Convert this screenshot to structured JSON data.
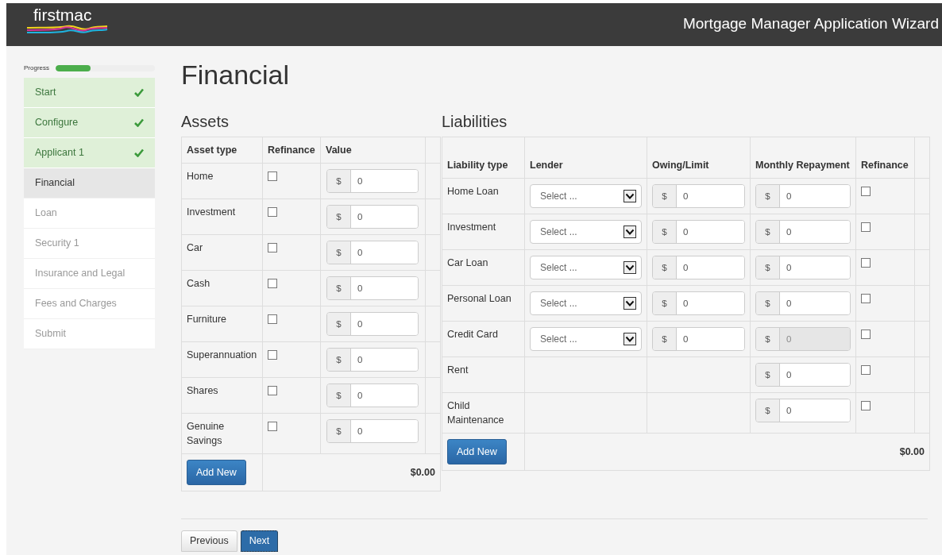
{
  "header": {
    "logo": "firstmac",
    "title": "Mortgage Manager Application Wizard"
  },
  "sidebar": {
    "progress_label": "Progress",
    "progress": {
      "level": 0.35
    },
    "steps": [
      {
        "label": "Start",
        "completed": true,
        "selected": false
      },
      {
        "label": "Configure",
        "completed": true,
        "selected": false
      },
      {
        "label": "Applicant 1",
        "completed": true,
        "selected": false
      },
      {
        "label": "Financial",
        "completed": false,
        "selected": true
      },
      {
        "label": "Loan",
        "completed": false,
        "selected": false
      },
      {
        "label": "Security 1",
        "completed": false,
        "selected": false
      },
      {
        "label": "Insurance and Legal",
        "completed": false,
        "selected": false
      },
      {
        "label": "Fees and Charges",
        "completed": false,
        "selected": false
      },
      {
        "label": "Submit",
        "completed": false,
        "selected": false
      }
    ]
  },
  "page_title": "Financial",
  "assets": {
    "heading": "Assets",
    "columns": [
      "Asset type",
      "Refinance",
      "Value"
    ],
    "rows": [
      {
        "type": "Home",
        "refinance": false,
        "currency": "$",
        "value": "0"
      },
      {
        "type": "Investment",
        "refinance": false,
        "currency": "$",
        "value": "0"
      },
      {
        "type": "Car",
        "refinance": false,
        "currency": "$",
        "value": "0"
      },
      {
        "type": "Cash",
        "refinance": false,
        "currency": "$",
        "value": "0"
      },
      {
        "type": "Furniture",
        "refinance": false,
        "currency": "$",
        "value": "0"
      },
      {
        "type": "Superannuation",
        "refinance": false,
        "currency": "$",
        "value": "0"
      },
      {
        "type": "Shares",
        "refinance": false,
        "currency": "$",
        "value": "0"
      },
      {
        "type": "Genuine Savings",
        "refinance": false,
        "currency": "$",
        "value": "0"
      }
    ],
    "add_button": "Add New",
    "total": "$0.00"
  },
  "liabilities": {
    "heading": "Liabilities",
    "columns": [
      "Liability type",
      "Lender",
      "Owing/Limit",
      "Monthly Repayment",
      "Refinance"
    ],
    "rows": [
      {
        "kind": "loan",
        "type": "Home Loan",
        "lender": "Select ...",
        "owing_currency": "$",
        "owing": "0",
        "repayment_currency": "$",
        "repayment": "0",
        "repayment_disabled": false,
        "refinance": false
      },
      {
        "kind": "loan",
        "type": "Investment",
        "lender": "Select ...",
        "owing_currency": "$",
        "owing": "0",
        "repayment_currency": "$",
        "repayment": "0",
        "repayment_disabled": false,
        "refinance": false
      },
      {
        "kind": "loan",
        "type": "Car Loan",
        "lender": "Select ...",
        "owing_currency": "$",
        "owing": "0",
        "repayment_currency": "$",
        "repayment": "0",
        "repayment_disabled": false,
        "refinance": false
      },
      {
        "kind": "loan",
        "type": "Personal Loan",
        "lender": "Select ...",
        "owing_currency": "$",
        "owing": "0",
        "repayment_currency": "$",
        "repayment": "0",
        "repayment_disabled": false,
        "refinance": false
      },
      {
        "kind": "loan",
        "type": "Credit Card",
        "lender": "Select ...",
        "owing_currency": "$",
        "owing": "0",
        "repayment_currency": "$",
        "repayment": "0",
        "repayment_disabled": true,
        "refinance": false
      },
      {
        "kind": "expense",
        "type": "Rent",
        "repayment_currency": "$",
        "repayment": "0",
        "repayment_disabled": false,
        "refinance": false
      },
      {
        "kind": "expense",
        "type": "Child Maintenance",
        "repayment_currency": "$",
        "repayment": "0",
        "repayment_disabled": false,
        "refinance": false
      }
    ],
    "add_button": "Add New",
    "total": "$0.00"
  },
  "nav_buttons": [
    {
      "kind": "secondary",
      "label": "Previous"
    },
    {
      "kind": "primary",
      "label": "Next"
    }
  ]
}
